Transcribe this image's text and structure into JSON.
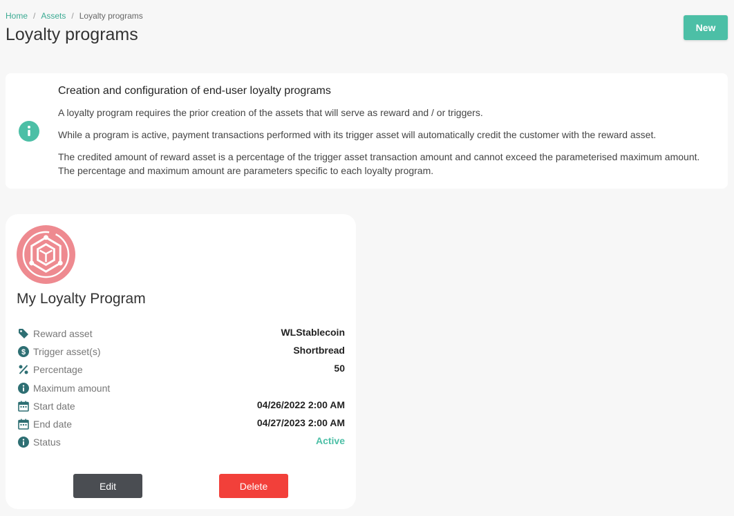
{
  "breadcrumb": {
    "home": "Home",
    "assets": "Assets",
    "current": "Loyalty programs",
    "separator": "/"
  },
  "page_title": "Loyalty programs",
  "new_button": "New",
  "info": {
    "title": "Creation and configuration of end-user loyalty programs",
    "p1": "A loyalty program requires the prior creation of the assets that will serve as reward and / or triggers.",
    "p2": "While a program is active, payment transactions performed with its trigger asset will automatically credit the customer with the reward asset.",
    "p3": "The credited amount of reward asset is a percentage of the trigger asset transaction amount and cannot exceed the parameterised maximum amount. The percentage and maximum amount are parameters specific to each loyalty program.",
    "icon": "info-icon"
  },
  "program": {
    "name": "My Loyalty Program",
    "logo": "loyalty-cube-icon",
    "fields": [
      {
        "label": "Reward asset",
        "value": "WLStablecoin",
        "icon": "tag-icon"
      },
      {
        "label": "Trigger asset(s)",
        "value": "Shortbread",
        "icon": "dollar-icon"
      },
      {
        "label": "Percentage",
        "value": "50",
        "icon": "percent-icon"
      },
      {
        "label": "Maximum amount",
        "value": "",
        "icon": "info-icon"
      },
      {
        "label": "Start date",
        "value": "04/26/2022 2:00 AM",
        "icon": "calendar-icon"
      },
      {
        "label": "End date",
        "value": "04/27/2023 2:00 AM",
        "icon": "calendar-icon"
      },
      {
        "label": "Status",
        "value": "Active",
        "icon": "info-icon"
      }
    ],
    "edit_label": "Edit",
    "delete_label": "Delete"
  },
  "colors": {
    "accent": "#4cbfa6",
    "link": "#3aaa92",
    "icon": "#2e6f73",
    "logo": "#ee8a90",
    "delete": "#f2403a",
    "edit": "#4a4d52"
  }
}
